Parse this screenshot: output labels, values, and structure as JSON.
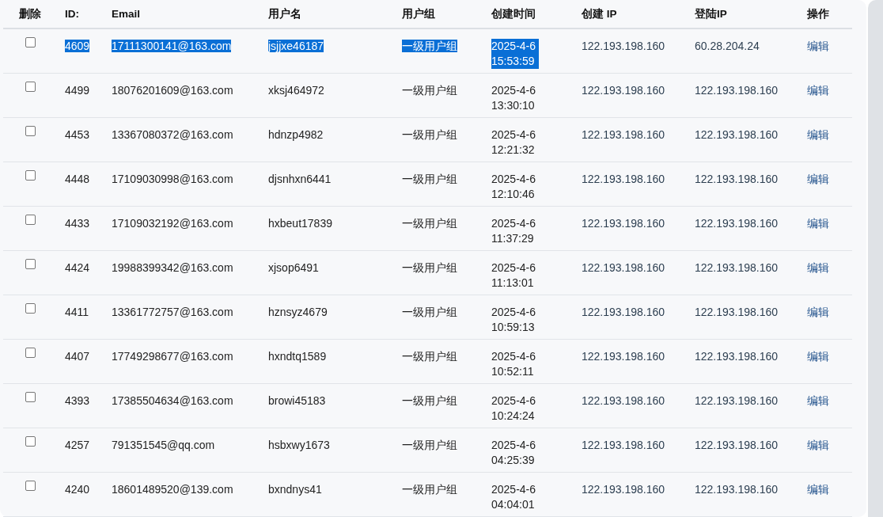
{
  "table": {
    "columns": [
      "删除",
      "ID:",
      "Email",
      "用户名",
      "用户组",
      "创建时间",
      "创建 IP",
      "登陆IP",
      "操作"
    ],
    "rows": [
      {
        "checked": false,
        "selected": true,
        "id": "4609",
        "email": "17111300141@163.com",
        "username": "jsjjxe46187",
        "group": "一级用户组",
        "created": "2025-4-6 15:53:59",
        "create_ip": "122.193.198.160",
        "login_ip": "60.28.204.24",
        "action": "编辑"
      },
      {
        "checked": false,
        "selected": false,
        "id": "4499",
        "email": "18076201609@163.com",
        "username": "xksj464972",
        "group": "一级用户组",
        "created": "2025-4-6 13:30:10",
        "create_ip": "122.193.198.160",
        "login_ip": "122.193.198.160",
        "action": "编辑"
      },
      {
        "checked": false,
        "selected": false,
        "id": "4453",
        "email": "13367080372@163.com",
        "username": "hdnzp4982",
        "group": "一级用户组",
        "created": "2025-4-6 12:21:32",
        "create_ip": "122.193.198.160",
        "login_ip": "122.193.198.160",
        "action": "编辑"
      },
      {
        "checked": false,
        "selected": false,
        "id": "4448",
        "email": "17109030998@163.com",
        "username": "djsnhxn6441",
        "group": "一级用户组",
        "created": "2025-4-6 12:10:46",
        "create_ip": "122.193.198.160",
        "login_ip": "122.193.198.160",
        "action": "编辑"
      },
      {
        "checked": false,
        "selected": false,
        "id": "4433",
        "email": "17109032192@163.com",
        "username": "hxbeut17839",
        "group": "一级用户组",
        "created": "2025-4-6 11:37:29",
        "create_ip": "122.193.198.160",
        "login_ip": "122.193.198.160",
        "action": "编辑"
      },
      {
        "checked": false,
        "selected": false,
        "id": "4424",
        "email": "19988399342@163.com",
        "username": "xjsop6491",
        "group": "一级用户组",
        "created": "2025-4-6 11:13:01",
        "create_ip": "122.193.198.160",
        "login_ip": "122.193.198.160",
        "action": "编辑"
      },
      {
        "checked": false,
        "selected": false,
        "id": "4411",
        "email": "13361772757@163.com",
        "username": "hznsyz4679",
        "group": "一级用户组",
        "created": "2025-4-6 10:59:13",
        "create_ip": "122.193.198.160",
        "login_ip": "122.193.198.160",
        "action": "编辑"
      },
      {
        "checked": false,
        "selected": false,
        "id": "4407",
        "email": "17749298677@163.com",
        "username": "hxndtq1589",
        "group": "一级用户组",
        "created": "2025-4-6 10:52:11",
        "create_ip": "122.193.198.160",
        "login_ip": "122.193.198.160",
        "action": "编辑"
      },
      {
        "checked": false,
        "selected": false,
        "id": "4393",
        "email": "17385504634@163.com",
        "username": "browi45183",
        "group": "一级用户组",
        "created": "2025-4-6 10:24:24",
        "create_ip": "122.193.198.160",
        "login_ip": "122.193.198.160",
        "action": "编辑"
      },
      {
        "checked": false,
        "selected": false,
        "id": "4257",
        "email": "791351545@qq.com",
        "username": "hsbxwy1673",
        "group": "一级用户组",
        "created": "2025-4-6 04:25:39",
        "create_ip": "122.193.198.160",
        "login_ip": "122.193.198.160",
        "action": "编辑"
      },
      {
        "checked": false,
        "selected": false,
        "id": "4240",
        "email": "18601489520@139.com",
        "username": "bxndnys41",
        "group": "一级用户组",
        "created": "2025-4-6 04:04:01",
        "create_ip": "122.193.198.160",
        "login_ip": "122.193.198.160",
        "action": "编辑"
      }
    ]
  }
}
